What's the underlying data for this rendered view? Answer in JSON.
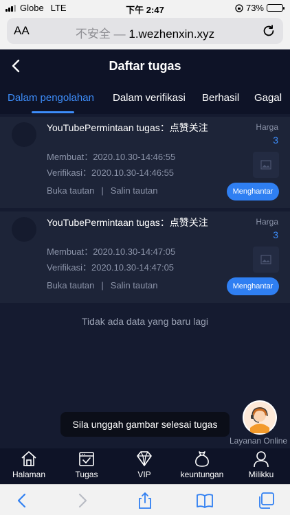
{
  "status_bar": {
    "carrier": "Globe",
    "network": "LTE",
    "time": "下午 2:47",
    "battery_percent": "73%",
    "battery_level": 0.73
  },
  "browser": {
    "text_size_label": "AA",
    "insecure_label": "不安全 —",
    "domain": "1.wezhenxin.xyz"
  },
  "header": {
    "title": "Daftar tugas"
  },
  "tabs": [
    {
      "label": "Dalam pengolahan",
      "active": true
    },
    {
      "label": "Dalam verifikasi",
      "active": false
    },
    {
      "label": "Berhasil",
      "active": false
    },
    {
      "label": "Gagal",
      "active": false
    }
  ],
  "tasks": [
    {
      "title": "YouTubePermintaan tugas：点赞关注",
      "created_label": "Membuat：",
      "created": "2020.10.30-14:46:55",
      "verified_label": "Verifikasi：",
      "verified": "2020.10.30-14:46:55",
      "open_link": "Buka tautan",
      "separator": "|",
      "copy_link": "Salin tautan",
      "price_label": "Harga",
      "price": "3",
      "submit_label": "Menghantar"
    },
    {
      "title": "YouTubePermintaan tugas：点赞关注",
      "created_label": "Membuat：",
      "created": "2020.10.30-14:47:05",
      "verified_label": "Verifikasi：",
      "verified": "2020.10.30-14:47:05",
      "open_link": "Buka tautan",
      "separator": "|",
      "copy_link": "Salin tautan",
      "price_label": "Harga",
      "price": "3",
      "submit_label": "Menghantar"
    }
  ],
  "empty_message": "Tidak ada data yang baru lagi",
  "toast": "Sila unggah gambar selesai tugas",
  "support": {
    "label": "Layanan Online"
  },
  "bottom_nav": [
    {
      "label": "Halaman",
      "icon": "home-icon"
    },
    {
      "label": "Tugas",
      "icon": "tasks-icon"
    },
    {
      "label": "VIP",
      "icon": "diamond-icon"
    },
    {
      "label": "keuntungan",
      "icon": "money-bag-icon"
    },
    {
      "label": "Milikku",
      "icon": "user-icon"
    }
  ],
  "colors": {
    "background": "#151b30",
    "card": "#1d2438",
    "accent": "#3d8dfa",
    "button": "#2f7ff2"
  }
}
